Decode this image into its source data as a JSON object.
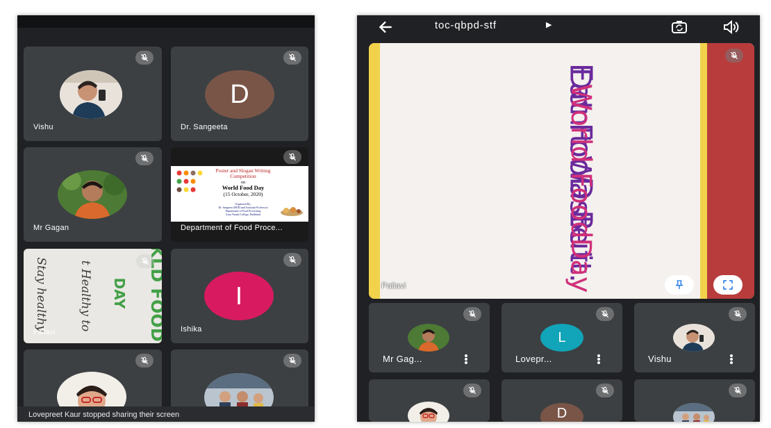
{
  "left_screen": {
    "tiles": [
      {
        "name": "Vishu"
      },
      {
        "name": "Dr. Sangeeta",
        "initial": "D"
      },
      {
        "name": "Mr Gagan"
      },
      {
        "name": "Department of Food Proce..."
      },
      {
        "name": "Pallavi"
      },
      {
        "name": "Ishika",
        "initial": "I"
      }
    ],
    "poster": {
      "title": "Poster and Slogan Writing Competition",
      "on": "on",
      "event": "World Food Day",
      "date": "(15 October, 2020)",
      "organised_by": "Organised By:",
      "line1": "Dr. Sangeeta (HOD and Assistant Professor)",
      "line2": "Department of Food Processing",
      "line3": "Guru Nanak College, Budhlada"
    },
    "pallavi_card": {
      "lines": [
        "KLD FOOD",
        "DAY",
        "t Healthy to",
        "Stay healthy"
      ]
    },
    "toast": "Lovepreet Kaur stopped sharing their screen"
  },
  "right_screen": {
    "meeting_code": "toc-qbpd-stf",
    "presenter": "Pallavi",
    "poster_lines": [
      "Eat FooD But",
      "Don't Waste it.",
      "World Food",
      "Day"
    ],
    "tiles": [
      {
        "name": "Mr Gag..."
      },
      {
        "name": "Lovepr...",
        "initial": "L"
      },
      {
        "name": "Vishu"
      },
      {
        "name": ""
      },
      {
        "name": "",
        "initial": "D"
      },
      {
        "name": ""
      }
    ]
  },
  "colors": {
    "bg": "#202124",
    "tile": "#3c4043",
    "d_avatar": "#795548",
    "i_avatar": "#d81b60",
    "l_avatar": "#12a4b8"
  },
  "icons": [
    "mic-off-icon",
    "back-arrow-icon",
    "switch-camera-icon",
    "speaker-icon",
    "pin-icon",
    "fullscreen-icon",
    "more-vert-icon"
  ]
}
